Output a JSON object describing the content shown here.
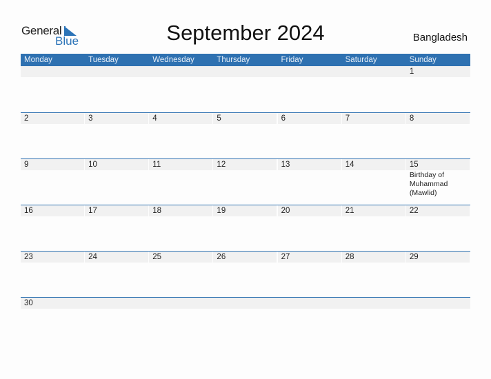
{
  "logo": {
    "general": "General",
    "blue": "Blue"
  },
  "title": "September 2024",
  "country": "Bangladesh",
  "weekdays": [
    "Monday",
    "Tuesday",
    "Wednesday",
    "Thursday",
    "Friday",
    "Saturday",
    "Sunday"
  ],
  "weeks": [
    [
      "",
      "",
      "",
      "",
      "",
      "",
      "1"
    ],
    [
      "2",
      "3",
      "4",
      "5",
      "6",
      "7",
      "8"
    ],
    [
      "9",
      "10",
      "11",
      "12",
      "13",
      "14",
      "15"
    ],
    [
      "16",
      "17",
      "18",
      "19",
      "20",
      "21",
      "22"
    ],
    [
      "23",
      "24",
      "25",
      "26",
      "27",
      "28",
      "29"
    ],
    [
      "30",
      "",
      "",
      "",
      "",
      "",
      ""
    ]
  ],
  "events": {
    "15": "Birthday of Muhammad (Mawlid)"
  },
  "colors": {
    "accent": "#2e71b1",
    "band": "#f1f1f1"
  }
}
